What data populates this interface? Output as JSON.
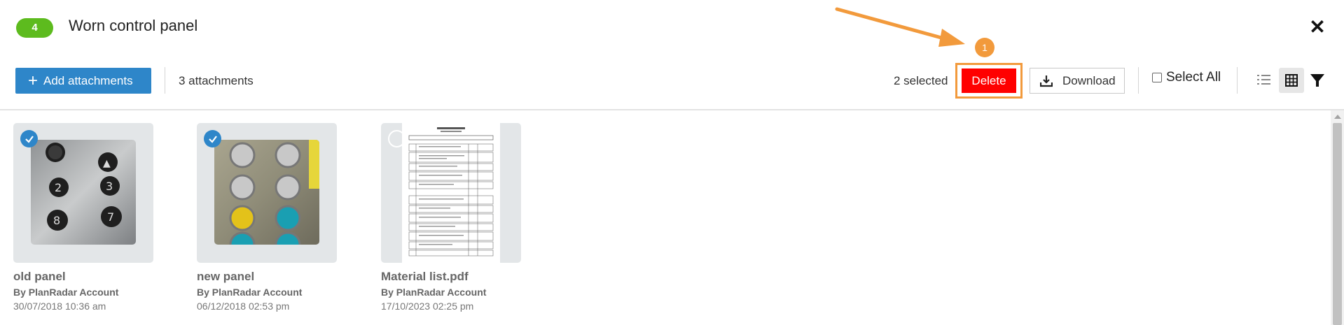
{
  "header": {
    "badge": "4",
    "title": "Worn control panel",
    "close_symbol": "✕"
  },
  "toolbar": {
    "add_label": "Add attachments",
    "attachments_count": "3 attachments",
    "selected_count": "2 selected",
    "delete_label": "Delete",
    "download_label": "Download",
    "select_all_label": "Select All"
  },
  "annotation": {
    "step": "1",
    "color": "#f29a3c"
  },
  "attachments": [
    {
      "name": "old panel",
      "author": "By PlanRadar Account",
      "date": "30/07/2018 10:36 am",
      "selected": true,
      "kind": "photo"
    },
    {
      "name": "new panel",
      "author": "By PlanRadar Account",
      "date": "06/12/2018 02:53 pm",
      "selected": true,
      "kind": "photo"
    },
    {
      "name": "Material list.pdf",
      "author": "By PlanRadar Account",
      "date": "17/10/2023 02:25 pm",
      "selected": false,
      "kind": "pdf"
    }
  ],
  "colors": {
    "primary": "#2e86c9",
    "badge": "#5dbb1e",
    "delete": "#ff0000"
  },
  "icons": [
    "plus-icon",
    "close-icon",
    "download-icon",
    "list-view-icon",
    "grid-view-icon",
    "filter-icon",
    "check-icon"
  ]
}
